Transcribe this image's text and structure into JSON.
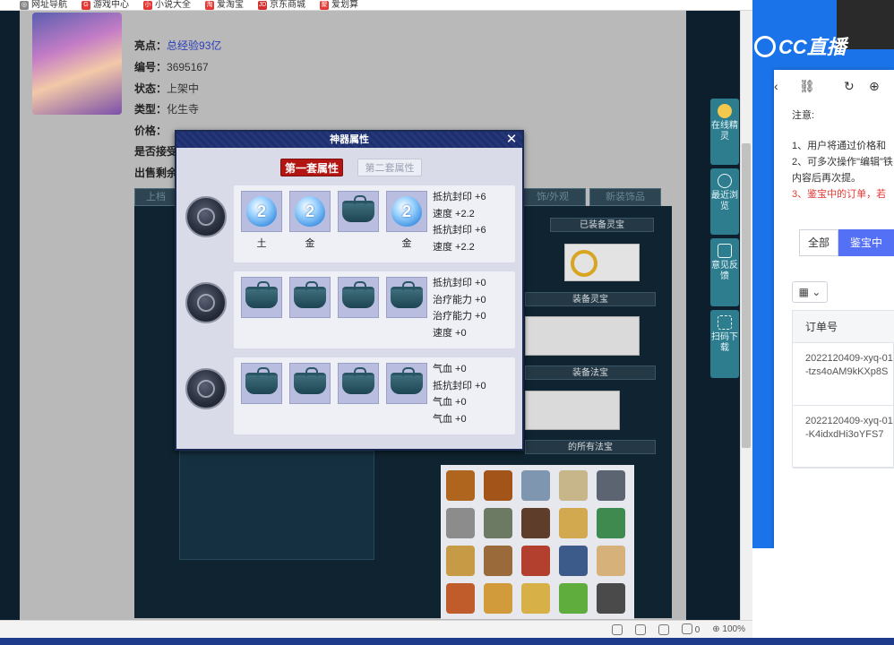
{
  "bookmarks": [
    {
      "label": "网址导航",
      "color": "#555"
    },
    {
      "label": "游戏中心",
      "color": "#e53935"
    },
    {
      "label": "小说大全",
      "color": "#e53935"
    },
    {
      "label": "爱淘宝",
      "color": "#e53935"
    },
    {
      "label": "京东商城",
      "color": "#d32f2f"
    },
    {
      "label": "爱划算",
      "color": "#e53935"
    }
  ],
  "listing": {
    "highlight_key": "亮点：",
    "highlight_val": "总经验93亿",
    "id_key": "编号：",
    "id_val": "3695167",
    "status_key": "状态：",
    "status_val": "上架中",
    "type_key": "类型：",
    "type_val": "化生寺",
    "price_key": "价格：",
    "accept_key": "是否接受",
    "remain_key": "出售剩余"
  },
  "dialog": {
    "title": "神器属性",
    "close_icon": "close-icon",
    "tab_active": "第一套属性",
    "tab_inactive": "第二套属性",
    "sets": [
      {
        "slots": [
          {
            "kind": "gem",
            "num": "2",
            "label": "土"
          },
          {
            "kind": "gem",
            "num": "2",
            "label": "金"
          },
          {
            "kind": "pot",
            "num": "",
            "label": ""
          },
          {
            "kind": "gem",
            "num": "2",
            "label": "金"
          }
        ],
        "attrs": [
          "抵抗封印 +6",
          "速度 +2.2",
          "抵抗封印 +6",
          "速度 +2.2"
        ]
      },
      {
        "slots": [
          {
            "kind": "pot",
            "num": "",
            "label": ""
          },
          {
            "kind": "pot",
            "num": "",
            "label": ""
          },
          {
            "kind": "pot",
            "num": "",
            "label": ""
          },
          {
            "kind": "pot",
            "num": "",
            "label": ""
          }
        ],
        "attrs": [
          "抵抗封印 +0",
          "治疗能力 +0",
          "治疗能力 +0",
          "速度 +0"
        ]
      },
      {
        "slots": [
          {
            "kind": "pot",
            "num": "",
            "label": ""
          },
          {
            "kind": "pot",
            "num": "",
            "label": ""
          },
          {
            "kind": "pot",
            "num": "",
            "label": ""
          },
          {
            "kind": "pot",
            "num": "",
            "label": ""
          }
        ],
        "attrs": [
          "气血 +0",
          "抵抗封印 +0",
          "气血 +0",
          "气血 +0"
        ]
      }
    ]
  },
  "game_panel": {
    "equipped_lingbao": "已装备灵宝",
    "equipped_lingbao2": "装备灵宝",
    "equipped_fabao": "装备法宝",
    "all_fabao": "的所有法宝",
    "tabs": [
      "上档",
      "饰/外观",
      "新装饰品"
    ]
  },
  "rail": [
    {
      "label": "在线精灵",
      "icon": "sprite-icon"
    },
    {
      "label": "最近浏览",
      "icon": "clock-icon"
    },
    {
      "label": "意见反馈",
      "icon": "edit-icon"
    },
    {
      "label": "扫码下载",
      "icon": "scan-icon"
    }
  ],
  "status_bar": {
    "badge": "0",
    "zoom": "100%"
  },
  "right_panel": {
    "logo": "CC直播",
    "notice_title": "注意:",
    "notes": [
      "1、用户将通过价格和",
      "2、可多次操作\"编辑\"铁",
      "内容后再次提。"
    ],
    "note_red": "3、鉴宝中的订单，若",
    "filter_all": "全部",
    "filter_active": "鉴宝中",
    "grid_btn": "▦ ⌄",
    "table_header": "订单号",
    "orders": [
      "2022120409-xyq-01-tzs4oAM9kKXp8S",
      "2022120409-xyq-01-K4idxdHi3oYFS7"
    ]
  }
}
